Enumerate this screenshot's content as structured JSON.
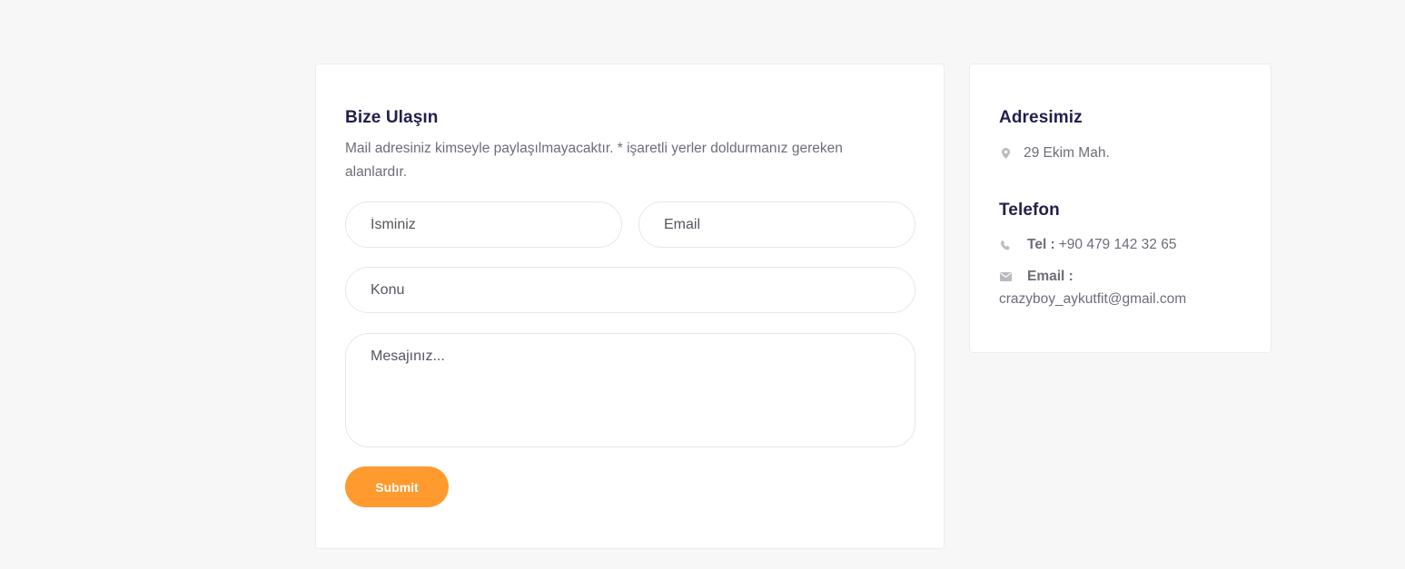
{
  "contact_form": {
    "title": "Bize Ulaşın",
    "description": "Mail adresiniz kimseyle paylaşılmayacaktır. * işaretli yerler doldurmanız gereken alanlardır.",
    "name_placeholder": "İsminiz",
    "email_placeholder": "Email",
    "subject_placeholder": "Konu",
    "message_placeholder": "Mesajınız...",
    "submit_label": "Submit"
  },
  "contact_info": {
    "address_title": "Adresimiz",
    "address": "29 Ekim Mah.",
    "address_icon": "map-marker-icon",
    "phone_title": "Telefon",
    "tel_label": "Tel :",
    "tel_value": "+90 479 142 32 65",
    "tel_icon": "phone-icon",
    "email_label": "Email :",
    "email_value": "crazyboy_aykutfit@gmail.com",
    "email_icon": "envelope-icon"
  },
  "colors": {
    "background": "#f7f7f7",
    "card": "#ffffff",
    "heading": "#221f4d",
    "body_text": "#6d6d78",
    "accent": "#ff9a2f",
    "icon": "#b9b9c0"
  }
}
